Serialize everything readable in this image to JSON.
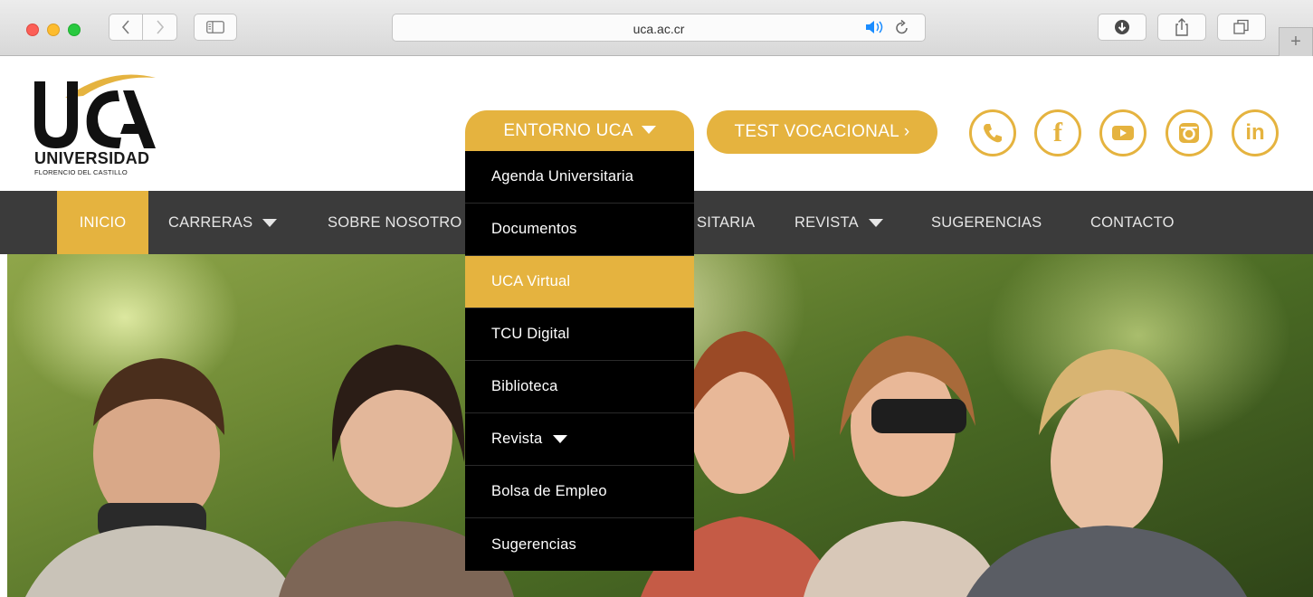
{
  "browser": {
    "url": "uca.ac.cr",
    "icons": {
      "back": "chevron-left-icon",
      "forward": "chevron-right-icon",
      "sidebar": "sidebar-icon",
      "audio": "speaker-icon",
      "reload": "reload-icon",
      "download": "download-icon",
      "share": "share-icon",
      "tabs": "tabs-icon",
      "new_tab": "plus-icon"
    }
  },
  "header": {
    "logo": {
      "letters": "UCA",
      "university": "UNIVERSIDAD",
      "subtitle": "FLORENCIO DEL CASTILLO"
    },
    "buttons": {
      "entorno": "ENTORNO UCA",
      "test": "TEST VOCACIONAL ›"
    },
    "social": [
      "phone-icon",
      "facebook-icon",
      "youtube-icon",
      "instagram-icon",
      "linkedin-icon"
    ]
  },
  "nav": {
    "items": [
      {
        "label": "INICIO",
        "active": true
      },
      {
        "label": "CARRERAS",
        "has_dropdown": true
      },
      {
        "label": "SOBRE NOSOTROS"
      },
      {
        "label": "VIDA UNIVERSITARIA"
      },
      {
        "label": "REVISTA",
        "has_dropdown": true
      },
      {
        "label": "SUGERENCIAS"
      },
      {
        "label": "CONTACTO"
      }
    ],
    "visible": {
      "sobre": "SOBRE NOSOTRO",
      "vida": "SITARIA"
    }
  },
  "dropdown": {
    "items": [
      {
        "label": "Agenda Universitaria"
      },
      {
        "label": "Documentos"
      },
      {
        "label": "UCA Virtual",
        "active": true
      },
      {
        "label": "TCU Digital"
      },
      {
        "label": "Biblioteca"
      },
      {
        "label": "Revista",
        "has_dropdown": true
      },
      {
        "label": "Bolsa de Empleo"
      },
      {
        "label": "Sugerencias"
      }
    ]
  },
  "colors": {
    "accent": "#e5b33f",
    "nav_bg": "#3b3b3b",
    "dropdown_bg": "#000000"
  }
}
